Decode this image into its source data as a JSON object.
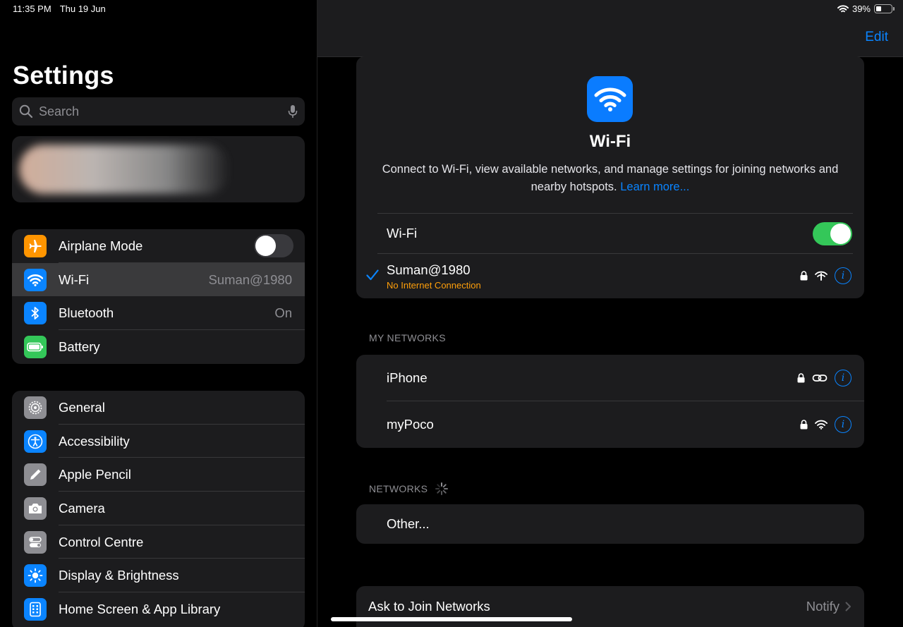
{
  "status": {
    "time": "11:35 PM",
    "date": "Thu 19 Jun",
    "battery": "39%",
    "battery_level": 0.39
  },
  "sidebar": {
    "title": "Settings",
    "search_placeholder": "Search",
    "group1": [
      {
        "label": "Airplane Mode",
        "icon": "airplane-icon",
        "color": "#ff9500",
        "toggle": "off"
      },
      {
        "label": "Wi-Fi",
        "icon": "wifi-icon",
        "color": "#0a84ff",
        "value": "Suman@1980",
        "selected": true
      },
      {
        "label": "Bluetooth",
        "icon": "bluetooth-icon",
        "color": "#0a84ff",
        "value": "On"
      },
      {
        "label": "Battery",
        "icon": "battery-icon",
        "color": "#34c759"
      }
    ],
    "group2": [
      {
        "label": "General",
        "icon": "gear-icon",
        "color": "#8e8e93"
      },
      {
        "label": "Accessibility",
        "icon": "accessibility-icon",
        "color": "#0a84ff"
      },
      {
        "label": "Apple Pencil",
        "icon": "pencil-icon",
        "color": "#8e8e93"
      },
      {
        "label": "Camera",
        "icon": "camera-icon",
        "color": "#8e8e93"
      },
      {
        "label": "Control Centre",
        "icon": "control-centre-icon",
        "color": "#8e8e93"
      },
      {
        "label": "Display & Brightness",
        "icon": "brightness-icon",
        "color": "#0a84ff"
      },
      {
        "label": "Home Screen & App Library",
        "icon": "home-screen-icon",
        "color": "#0a84ff"
      }
    ]
  },
  "detail": {
    "edit_label": "Edit",
    "hero_title": "Wi-Fi",
    "hero_desc": "Connect to Wi-Fi, view available networks, and manage settings for joining networks and nearby hotspots.",
    "hero_link": "Learn more...",
    "wifi_toggle_label": "Wi-Fi",
    "wifi_toggle": "on",
    "connected": {
      "name": "Suman@1980",
      "status": "No Internet Connection"
    },
    "my_networks_header": "MY NETWORKS",
    "my_networks": [
      {
        "name": "iPhone",
        "type": "hotspot"
      },
      {
        "name": "myPoco",
        "type": "wifi"
      }
    ],
    "networks_header": "NETWORKS",
    "other_label": "Other...",
    "ask_to_join_label": "Ask to Join Networks",
    "ask_to_join_value": "Notify"
  }
}
